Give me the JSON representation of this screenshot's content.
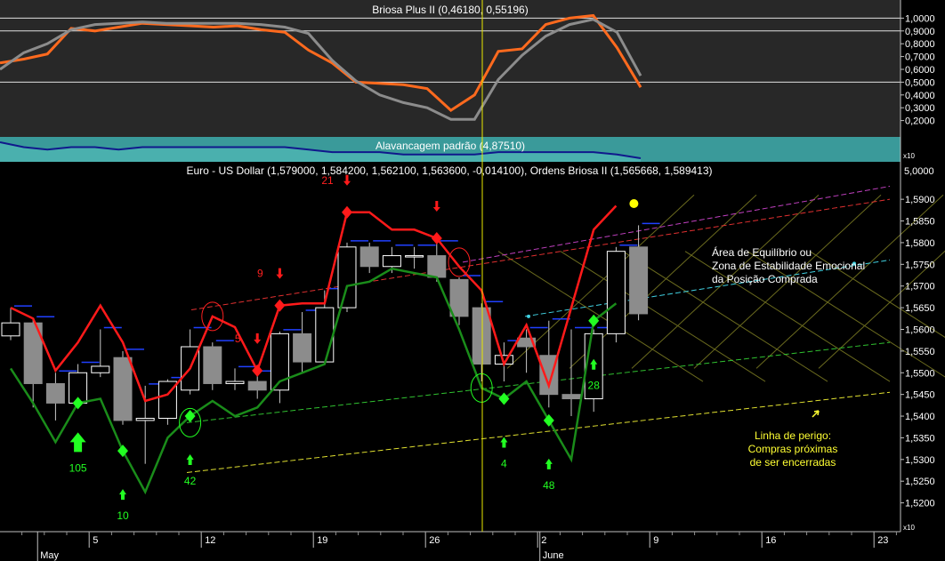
{
  "chart_data": [
    {
      "type": "line",
      "title": "Briosa Plus II (0,46180, 0,55196)",
      "ylim": [
        0.1,
        1.1
      ],
      "y_tick_labels": [
        "1,0000",
        "0,9000",
        "0,8000",
        "0,7000",
        "0,6000",
        "0,5000",
        "0,4000",
        "0,3000",
        "0,2000"
      ],
      "y_tick_values": [
        1.0,
        0.9,
        0.8,
        0.7,
        0.6,
        0.5,
        0.4,
        0.3,
        0.2
      ],
      "reference_levels": [
        1.0,
        0.9,
        0.5
      ],
      "x": [
        0,
        1,
        2,
        3,
        4,
        5,
        6,
        7,
        8,
        9,
        10,
        11,
        12,
        13,
        14,
        15,
        16,
        17,
        18,
        19,
        20,
        21,
        22,
        23,
        24,
        25,
        26,
        27
      ],
      "series": [
        {
          "color": "#ff6a1e",
          "values": [
            0.65,
            0.68,
            0.72,
            0.92,
            0.9,
            0.93,
            0.96,
            0.95,
            0.94,
            0.93,
            0.94,
            0.91,
            0.89,
            0.75,
            0.65,
            0.5,
            0.49,
            0.48,
            0.45,
            0.28,
            0.4,
            0.74,
            0.76,
            0.95,
            1.0,
            1.02,
            0.77,
            0.46
          ]
        },
        {
          "color": "#8c8c8c",
          "values": [
            0.6,
            0.73,
            0.8,
            0.91,
            0.95,
            0.96,
            0.97,
            0.96,
            0.96,
            0.96,
            0.96,
            0.95,
            0.93,
            0.88,
            0.67,
            0.51,
            0.4,
            0.34,
            0.3,
            0.21,
            0.21,
            0.52,
            0.71,
            0.86,
            0.95,
            0.99,
            0.89,
            0.55
          ]
        }
      ]
    },
    {
      "type": "area",
      "title": "Alavancagem padrão (4,87510)",
      "y_tick_labels": [
        "5,0000"
      ],
      "corner_label": "x10",
      "series": [
        {
          "color": "#10188c",
          "values": [
            4.94,
            4.92,
            4.91,
            4.92,
            4.92,
            4.91,
            4.92,
            4.92,
            4.92,
            4.92,
            4.92,
            4.92,
            4.92,
            4.91,
            4.9,
            4.9,
            4.9,
            4.89,
            4.89,
            4.89,
            4.89,
            4.9,
            4.9,
            4.9,
            4.9,
            4.9,
            4.89,
            4.875
          ]
        }
      ]
    },
    {
      "type": "candlestick",
      "title": "Euro - US Dollar (1,579000, 1,584200, 1,562100, 1,563600, -0,014100), Ordens Briosa II (1,565668, 1,589413)",
      "ylim": [
        1.515,
        1.597
      ],
      "y_tick_labels": [
        "1,5900",
        "1,5850",
        "1,5800",
        "1,5750",
        "1,5700",
        "1,5650",
        "1,5600",
        "1,5550",
        "1,5500",
        "1,5450",
        "1,5400",
        "1,5350",
        "1,5300",
        "1,5250",
        "1,5200"
      ],
      "y_tick_values": [
        1.59,
        1.585,
        1.58,
        1.575,
        1.57,
        1.565,
        1.56,
        1.555,
        1.55,
        1.545,
        1.54,
        1.535,
        1.53,
        1.525,
        1.52
      ],
      "x_tick_labels": [
        "5",
        "12",
        "19",
        "26",
        "2",
        "9",
        "16",
        "23"
      ],
      "x_tick_index": [
        3.5,
        8.5,
        13.5,
        18.5,
        23.5,
        28.5,
        33.5,
        38.5
      ],
      "month_labels": [
        {
          "label": "May",
          "index": 1.2
        },
        {
          "label": "June",
          "index": 23.6
        }
      ],
      "candles": [
        {
          "o": 1.5585,
          "h": 1.565,
          "c": 1.5615,
          "l": 1.5575
        },
        {
          "o": 1.5615,
          "h": 1.5625,
          "c": 1.5475,
          "l": 1.542
        },
        {
          "o": 1.5475,
          "h": 1.55,
          "c": 1.543,
          "l": 1.539
        },
        {
          "o": 1.543,
          "h": 1.552,
          "c": 1.55,
          "l": 1.542
        },
        {
          "o": 1.55,
          "h": 1.56,
          "c": 1.5515,
          "l": 1.549
        },
        {
          "o": 1.5535,
          "h": 1.555,
          "c": 1.539,
          "l": 1.538
        },
        {
          "o": 1.539,
          "h": 1.547,
          "c": 1.5395,
          "l": 1.529
        },
        {
          "o": 1.5395,
          "h": 1.5485,
          "c": 1.548,
          "l": 1.538
        },
        {
          "o": 1.546,
          "h": 1.56,
          "c": 1.556,
          "l": 1.545
        },
        {
          "o": 1.556,
          "h": 1.557,
          "c": 1.5475,
          "l": 1.546
        },
        {
          "o": 1.5475,
          "h": 1.551,
          "c": 1.548,
          "l": 1.546
        },
        {
          "o": 1.548,
          "h": 1.55,
          "c": 1.546,
          "l": 1.544
        },
        {
          "o": 1.546,
          "h": 1.5595,
          "c": 1.559,
          "l": 1.543
        },
        {
          "o": 1.559,
          "h": 1.564,
          "c": 1.5525,
          "l": 1.55
        },
        {
          "o": 1.5525,
          "h": 1.569,
          "c": 1.565,
          "l": 1.552
        },
        {
          "o": 1.565,
          "h": 1.58,
          "c": 1.579,
          "l": 1.564
        },
        {
          "o": 1.579,
          "h": 1.58,
          "c": 1.5745,
          "l": 1.573
        },
        {
          "o": 1.5745,
          "h": 1.579,
          "c": 1.577,
          "l": 1.573
        },
        {
          "o": 1.577,
          "h": 1.579,
          "c": 1.577,
          "l": 1.574
        },
        {
          "o": 1.577,
          "h": 1.58,
          "c": 1.572,
          "l": 1.571
        },
        {
          "o": 1.5715,
          "h": 1.572,
          "c": 1.563,
          "l": 1.561
        },
        {
          "o": 1.565,
          "h": 1.566,
          "c": 1.552,
          "l": 1.548
        },
        {
          "o": 1.552,
          "h": 1.557,
          "c": 1.554,
          "l": 1.548
        },
        {
          "o": 1.558,
          "h": 1.56,
          "c": 1.556,
          "l": 1.55
        },
        {
          "o": 1.554,
          "h": 1.562,
          "c": 1.545,
          "l": 1.542
        },
        {
          "o": 1.545,
          "h": 1.56,
          "c": 1.544,
          "l": 1.54
        },
        {
          "o": 1.544,
          "h": 1.56,
          "c": 1.559,
          "l": 1.541
        },
        {
          "o": 1.559,
          "h": 1.579,
          "c": 1.578,
          "l": 1.557
        },
        {
          "o": 1.579,
          "h": 1.584,
          "c": 1.5636,
          "l": 1.5621
        }
      ],
      "red_line": [
        1.565,
        1.5625,
        1.5505,
        1.557,
        1.5655,
        1.557,
        1.5435,
        1.545,
        1.551,
        1.563,
        1.5605,
        1.5505,
        1.5655,
        1.566,
        1.566,
        1.587,
        1.587,
        1.583,
        1.583,
        1.581,
        1.5745,
        1.569,
        1.552,
        1.561,
        1.547,
        1.565,
        1.583,
        1.5885
      ],
      "green_line": [
        1.551,
        1.543,
        1.534,
        1.543,
        1.544,
        1.532,
        1.5225,
        1.535,
        1.54,
        1.5435,
        1.54,
        1.542,
        1.548,
        1.55,
        1.552,
        1.57,
        1.571,
        1.574,
        1.573,
        1.572,
        1.56,
        1.5465,
        1.544,
        1.548,
        1.539,
        1.53,
        1.562,
        1.566
      ],
      "buy_signals": [
        {
          "index": 3,
          "label": "105"
        },
        {
          "index": 5,
          "label": "10"
        },
        {
          "index": 8,
          "label": "42"
        },
        {
          "index": 22,
          "label": "4"
        },
        {
          "index": 24,
          "label": "48"
        },
        {
          "index": 26,
          "label": "28"
        }
      ],
      "sell_signals": [
        {
          "index": 11,
          "label": "5"
        },
        {
          "index": 12,
          "label": "9"
        },
        {
          "index": 15,
          "label": "21"
        },
        {
          "index": 19,
          "label": ""
        }
      ],
      "annotations": [
        "Área de Equilíbrio ou",
        "Zona de Estabilidade Emocional",
        "da Posição Comprada",
        "Linha de perigo:",
        "Compras próximas",
        "de ser encerradas"
      ],
      "corner_label": "x10"
    }
  ]
}
